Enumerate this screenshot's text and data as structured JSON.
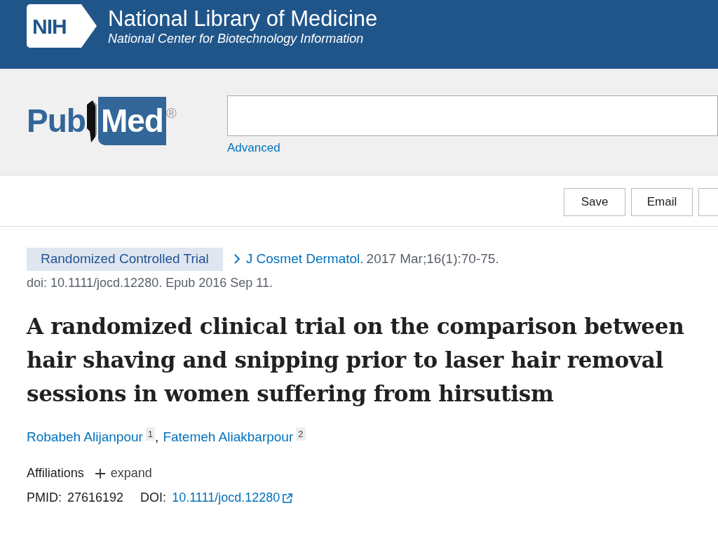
{
  "header": {
    "agency": "NIH",
    "title": "National Library of Medicine",
    "subtitle": "National Center for Biotechnology Information"
  },
  "search": {
    "logo_left": "Pub",
    "logo_right": "Med",
    "registered": "®",
    "advanced": "Advanced"
  },
  "actions": [
    "Save",
    "Email"
  ],
  "article": {
    "publication_type": "Randomized Controlled Trial",
    "journal": "J Cosmet Dermatol.",
    "citation": "2017 Mar;16(1):70-75.",
    "doi_line": "doi: 10.1111/jocd.12280. Epub 2016 Sep 11.",
    "title": "A randomized clinical trial on the comparison between hair shaving and snipping prior to laser hair removal sessions in women suffering from hirsutism",
    "authors": [
      {
        "name": "Robabeh Alijanpour",
        "affiliation": "1"
      },
      {
        "name": "Fatemeh Aliakbarpour",
        "affiliation": "2"
      }
    ],
    "author_separator": ",",
    "affiliations_label": "Affiliations",
    "expand_label": "expand",
    "pmid_label": "PMID:",
    "pmid": "27616192",
    "doi_label": "DOI:",
    "doi": "10.1111/jocd.12280"
  }
}
